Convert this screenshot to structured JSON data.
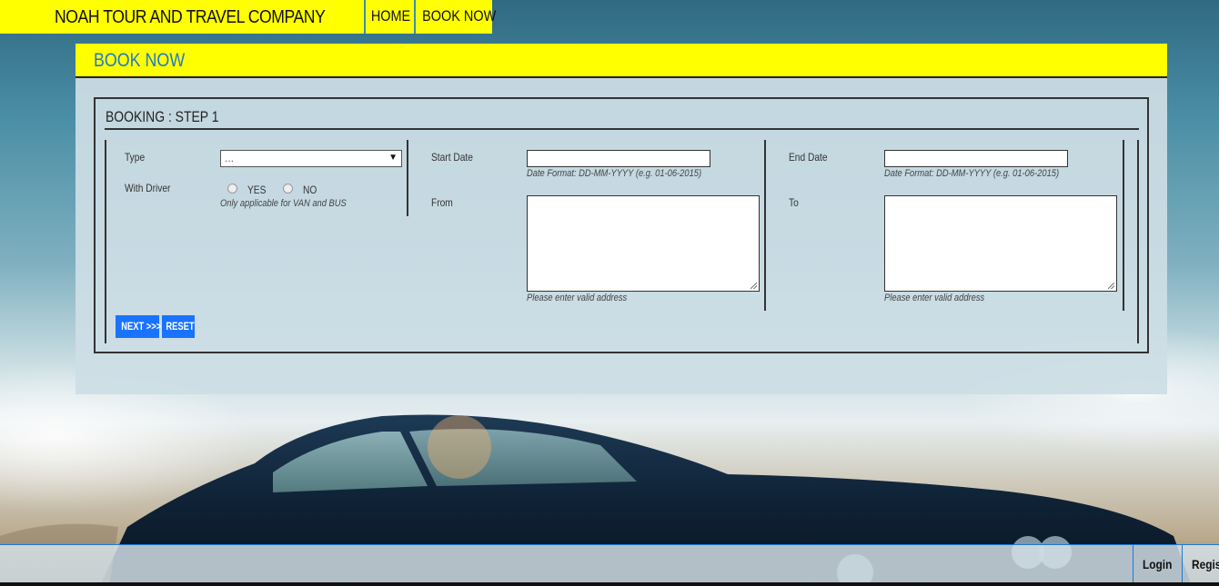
{
  "header": {
    "brand": "NOAH TOUR AND TRAVEL COMPANY",
    "nav": [
      {
        "label": "HOME"
      },
      {
        "label": "BOOK NOW"
      }
    ]
  },
  "panel": {
    "title": "BOOK NOW",
    "step_title": "BOOKING : STEP 1"
  },
  "form": {
    "type_label": "Type",
    "type_value": "...",
    "driver_label": "With Driver",
    "yes_label": "YES",
    "no_label": "NO",
    "driver_hint": "Only applicable for VAN and BUS",
    "start_label": "Start Date",
    "start_hint": "Date Format: DD-MM-YYYY (e.g. 01-06-2015)",
    "end_label": "End Date",
    "end_hint": "Date Format: DD-MM-YYYY (e.g. 01-06-2015)",
    "from_label": "From",
    "from_hint": "Please enter valid address",
    "to_label": "To",
    "to_hint": "Please enter valid address",
    "next_label": "NEXT >>>",
    "reset_label": "RESET"
  },
  "footer": {
    "login": "Login",
    "register": "Regis"
  },
  "colors": {
    "accent_yellow": "#ffff00",
    "title_blue": "#1e78d2",
    "button_blue": "#1a73ff"
  }
}
